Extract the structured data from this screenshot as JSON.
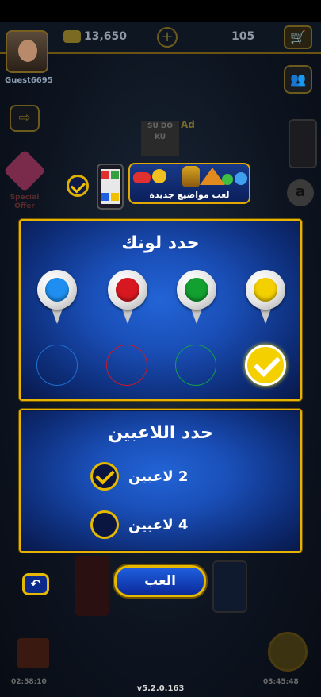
{
  "background": {
    "username": "Guest6695",
    "coins": "13,650",
    "gems": "105",
    "ad_label": "Ad",
    "sudoku_letters": "SU DO KU",
    "special_offer": "Special Offer",
    "amazon_glyph": "a",
    "timer_left": "02:58:10",
    "timer_right": "03:45:48",
    "version": "v5.2.0.163"
  },
  "promo": {
    "text": "لعب مواضيع جديدة",
    "checked": true
  },
  "color_panel": {
    "title": "حدد لونك",
    "colors": [
      {
        "name": "blue",
        "hex": "#1e8ff0",
        "ring": "#1e6fd0",
        "selected": false
      },
      {
        "name": "red",
        "hex": "#d81820",
        "ring": "#c81a28",
        "selected": false
      },
      {
        "name": "green",
        "hex": "#12a030",
        "ring": "#12a048",
        "selected": false
      },
      {
        "name": "yellow",
        "hex": "#f4d000",
        "ring": "#f4d000",
        "selected": true
      }
    ]
  },
  "players_panel": {
    "title": "حدد اللاعبين",
    "options": [
      {
        "label": "2 لاعبين",
        "selected": true
      },
      {
        "label": "4 لاعبين",
        "selected": false
      }
    ]
  },
  "buttons": {
    "play": "العب",
    "back_icon": "back-arrow-icon"
  },
  "colors": {
    "accent_gold": "#e5b300",
    "panel_blue": "#1a4fb8"
  }
}
